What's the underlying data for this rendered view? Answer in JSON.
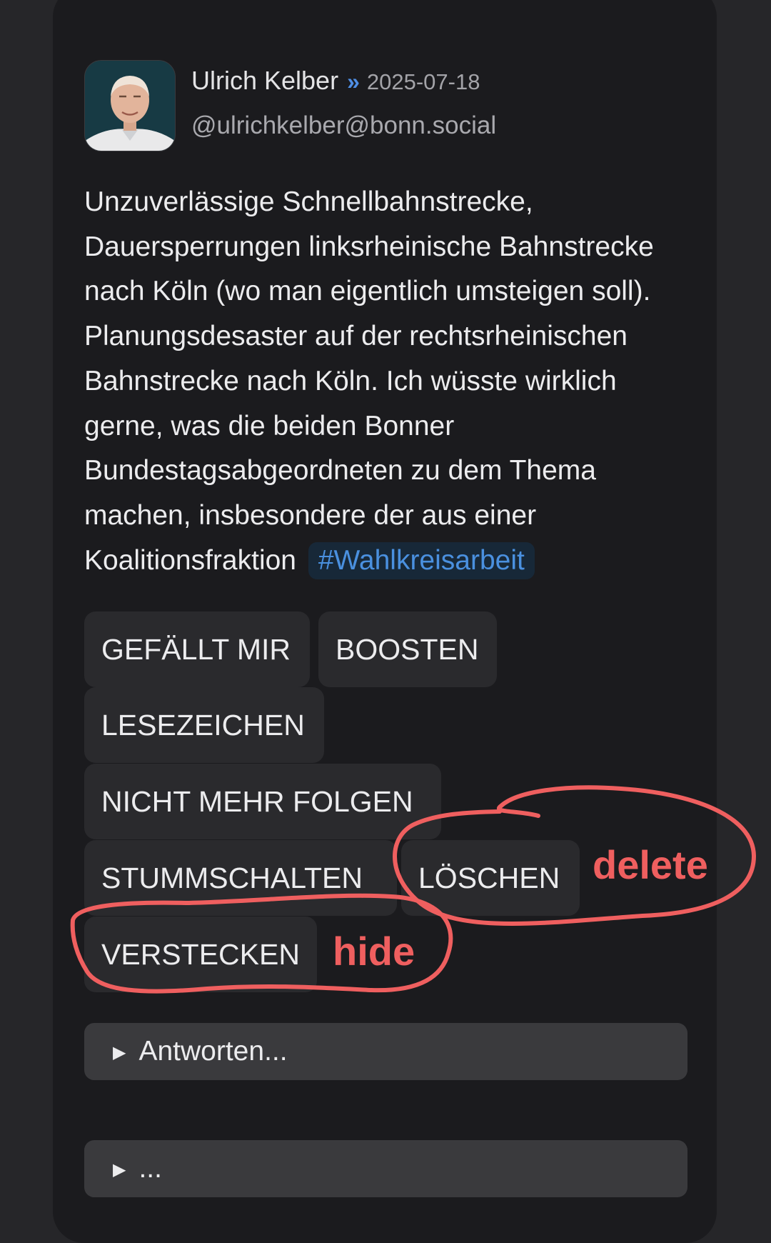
{
  "post": {
    "author_name": "Ulrich Kelber",
    "separator": "»",
    "date": "2025-07-18",
    "handle": "@ulrichkelber@bonn.social",
    "body": "Unzuverlässige Schnellbahnstrecke, Dauersperrungen linksrheinische Bahnstrecke nach Köln (wo man eigentlich umsteigen soll). Planungsdesaster auf der rechtsrheinischen Bahnstrecke nach Köln. Ich wüsste wirklich gerne, was die beiden Bonner Bundestagsabgeordneten zu dem Thema machen, insbesondere der aus einer Koalitionsfraktion",
    "hashtag": "#Wahlkreisarbeit"
  },
  "actions": {
    "like": "GEFÄLLT MIR",
    "boost": "BOOSTEN",
    "bookmark": "LESEZEICHEN",
    "unfollow": "NICHT MEHR FOLGEN",
    "mute": "STUMMSCHALTEN",
    "delete": "LÖSCHEN",
    "hide": "VERSTECKEN"
  },
  "reply": {
    "marker": "▶",
    "label": "Antworten...",
    "more_label": "..."
  },
  "annotations": {
    "delete_label": "delete",
    "hide_label": "hide",
    "color": "#ef5f5f"
  },
  "colors": {
    "page_bg": "#262629",
    "card_bg": "#1b1b1e",
    "button_bg": "#2a2a2d",
    "reply_bg": "#3a3a3d",
    "accent": "#4a90df"
  },
  "icons": {
    "avatar": "author-photo",
    "reply_toggle": "triangle-right-icon"
  }
}
